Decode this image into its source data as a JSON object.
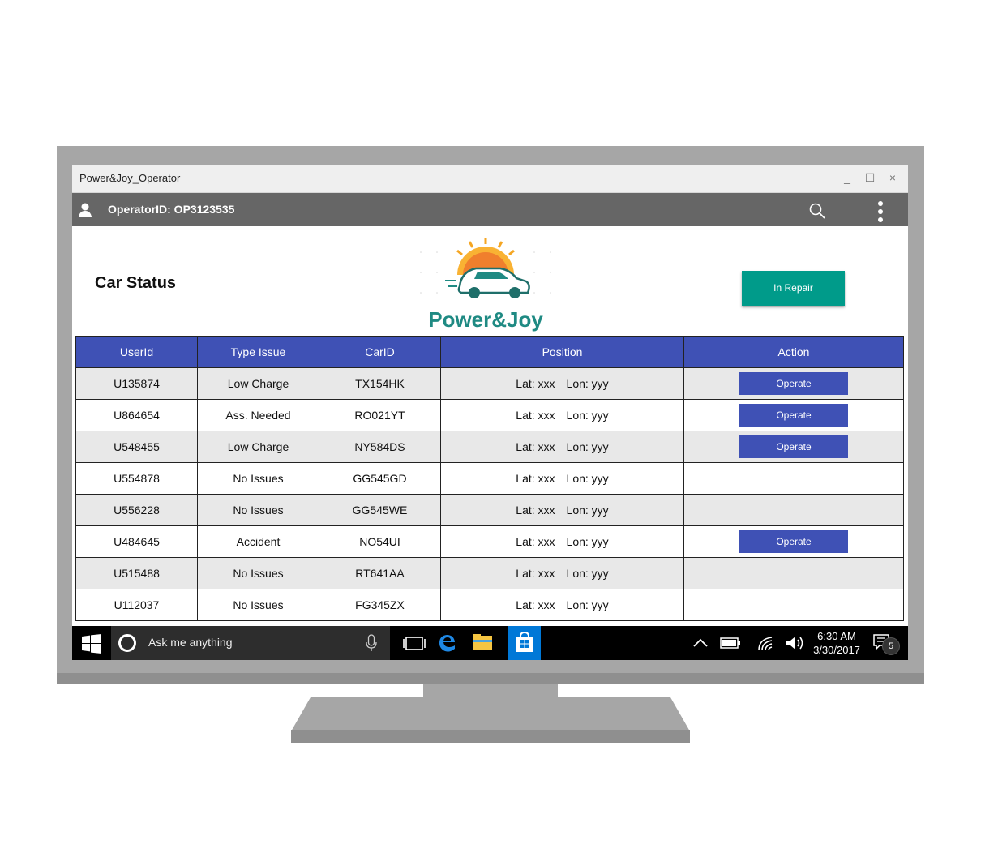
{
  "window": {
    "title": "Power&Joy_Operator",
    "minimize": "_",
    "maximize": "☐",
    "close": "×"
  },
  "appbar": {
    "operator": "OperatorID: OP3123535"
  },
  "page": {
    "title": "Car Status",
    "logo_text": "Power&Joy",
    "repair_button": "In Repair"
  },
  "table": {
    "headers": [
      "UserId",
      "Type Issue",
      "CarID",
      "Position",
      "Action"
    ],
    "rows": [
      {
        "user": "U135874",
        "issue": "Low Charge",
        "car": "TX154HK",
        "lat": "Lat: xxx",
        "lon": "Lon: yyy",
        "action": "Operate"
      },
      {
        "user": "U864654",
        "issue": "Ass. Needed",
        "car": "RO021YT",
        "lat": "Lat: xxx",
        "lon": "Lon: yyy",
        "action": "Operate"
      },
      {
        "user": "U548455",
        "issue": "Low Charge",
        "car": "NY584DS",
        "lat": "Lat: xxx",
        "lon": "Lon: yyy",
        "action": "Operate"
      },
      {
        "user": "U554878",
        "issue": "No Issues",
        "car": "GG545GD",
        "lat": "Lat: xxx",
        "lon": "Lon: yyy",
        "action": ""
      },
      {
        "user": "U556228",
        "issue": "No Issues",
        "car": "GG545WE",
        "lat": "Lat: xxx",
        "lon": "Lon: yyy",
        "action": ""
      },
      {
        "user": "U484645",
        "issue": "Accident",
        "car": "NO54UI",
        "lat": "Lat: xxx",
        "lon": "Lon: yyy",
        "action": "Operate"
      },
      {
        "user": "U515488",
        "issue": "No Issues",
        "car": "RT641AA",
        "lat": "Lat: xxx",
        "lon": "Lon: yyy",
        "action": ""
      },
      {
        "user": "U112037",
        "issue": "No Issues",
        "car": "FG345ZX",
        "lat": "Lat: xxx",
        "lon": "Lon: yyy",
        "action": ""
      }
    ]
  },
  "taskbar": {
    "search_placeholder": "Ask me anything",
    "time": "6:30 AM",
    "date": "3/30/2017",
    "notifications": "5"
  },
  "colors": {
    "appbar": "#666666",
    "accent_teal": "#009b8a",
    "table_header": "#3f51b5",
    "taskbar": "#000000"
  },
  "icons": [
    "user-icon",
    "search-icon",
    "more-vert-icon",
    "windows-start-icon",
    "cortana-icon",
    "microphone-icon",
    "task-view-icon",
    "edge-icon",
    "file-explorer-icon",
    "store-icon",
    "chevron-up-icon",
    "battery-icon",
    "wifi-icon",
    "volume-icon",
    "action-center-icon"
  ]
}
